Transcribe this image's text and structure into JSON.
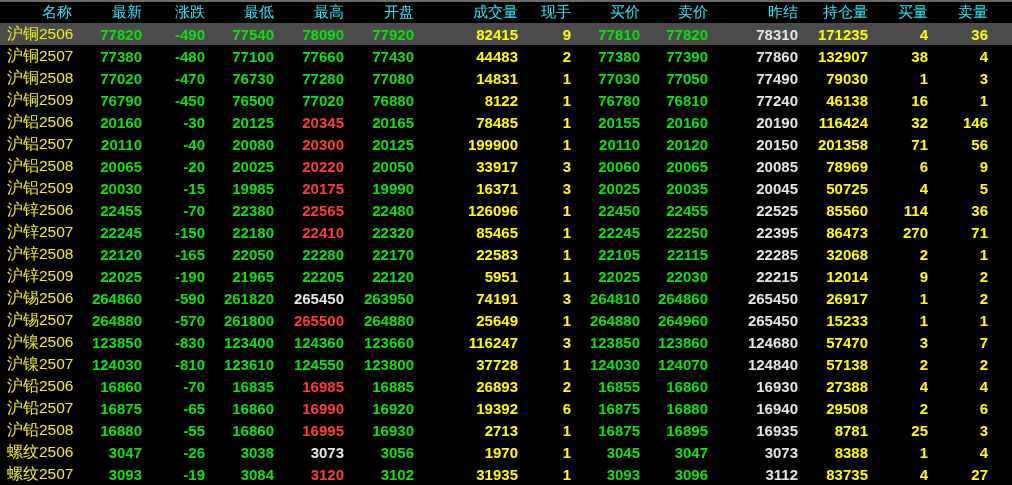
{
  "table": {
    "columns": [
      {
        "label": "名称",
        "kind": "name"
      },
      {
        "label": "最新",
        "kind": "price"
      },
      {
        "label": "涨跌",
        "kind": "price"
      },
      {
        "label": "最低",
        "kind": "price"
      },
      {
        "label": "最高",
        "kind": "price"
      },
      {
        "label": "开盘",
        "kind": "price"
      },
      {
        "label": "成交量",
        "kind": "volume"
      },
      {
        "label": "现手",
        "kind": "volume"
      },
      {
        "label": "买价",
        "kind": "price"
      },
      {
        "label": "卖价",
        "kind": "price"
      },
      {
        "label": "昨结",
        "kind": "settle"
      },
      {
        "label": "持仓量",
        "kind": "volume"
      },
      {
        "label": "买量",
        "kind": "volume"
      },
      {
        "label": "卖量",
        "kind": "volume"
      }
    ],
    "rows": [
      {
        "selected": true,
        "cells": [
          {
            "text": "沪铜2506"
          },
          {
            "text": "77820",
            "color": "#10e010"
          },
          {
            "text": "-490",
            "color": "#10e010"
          },
          {
            "text": "77540",
            "color": "#10e010"
          },
          {
            "text": "78090",
            "color": "#10e010"
          },
          {
            "text": "77920",
            "color": "#10e010"
          },
          {
            "text": "82415"
          },
          {
            "text": "9"
          },
          {
            "text": "77810",
            "color": "#10e010"
          },
          {
            "text": "77820",
            "color": "#10e010"
          },
          {
            "text": "78310"
          },
          {
            "text": "171235"
          },
          {
            "text": "4"
          },
          {
            "text": "36"
          }
        ]
      },
      {
        "selected": false,
        "cells": [
          {
            "text": "沪铜2507"
          },
          {
            "text": "77380",
            "color": "#10e010"
          },
          {
            "text": "-480",
            "color": "#10e010"
          },
          {
            "text": "77100",
            "color": "#10e010"
          },
          {
            "text": "77660",
            "color": "#10e010"
          },
          {
            "text": "77430",
            "color": "#10e010"
          },
          {
            "text": "44483"
          },
          {
            "text": "2"
          },
          {
            "text": "77380",
            "color": "#10e010"
          },
          {
            "text": "77390",
            "color": "#10e010"
          },
          {
            "text": "77860"
          },
          {
            "text": "132907"
          },
          {
            "text": "38"
          },
          {
            "text": "4"
          }
        ]
      },
      {
        "selected": false,
        "cells": [
          {
            "text": "沪铜2508"
          },
          {
            "text": "77020",
            "color": "#10e010"
          },
          {
            "text": "-470",
            "color": "#10e010"
          },
          {
            "text": "76730",
            "color": "#10e010"
          },
          {
            "text": "77280",
            "color": "#10e010"
          },
          {
            "text": "77080",
            "color": "#10e010"
          },
          {
            "text": "14831"
          },
          {
            "text": "1"
          },
          {
            "text": "77030",
            "color": "#10e010"
          },
          {
            "text": "77050",
            "color": "#10e010"
          },
          {
            "text": "77490"
          },
          {
            "text": "79030"
          },
          {
            "text": "1"
          },
          {
            "text": "3"
          }
        ]
      },
      {
        "selected": false,
        "cells": [
          {
            "text": "沪铜2509"
          },
          {
            "text": "76790",
            "color": "#10e010"
          },
          {
            "text": "-450",
            "color": "#10e010"
          },
          {
            "text": "76500",
            "color": "#10e010"
          },
          {
            "text": "77020",
            "color": "#10e010"
          },
          {
            "text": "76880",
            "color": "#10e010"
          },
          {
            "text": "8122"
          },
          {
            "text": "1"
          },
          {
            "text": "76780",
            "color": "#10e010"
          },
          {
            "text": "76810",
            "color": "#10e010"
          },
          {
            "text": "77240"
          },
          {
            "text": "46138"
          },
          {
            "text": "16"
          },
          {
            "text": "1"
          }
        ]
      },
      {
        "selected": false,
        "cells": [
          {
            "text": "沪铝2506"
          },
          {
            "text": "20160",
            "color": "#10e010"
          },
          {
            "text": "-30",
            "color": "#10e010"
          },
          {
            "text": "20125",
            "color": "#10e010"
          },
          {
            "text": "20345",
            "color": "#ff3c3c"
          },
          {
            "text": "20165",
            "color": "#10e010"
          },
          {
            "text": "78485"
          },
          {
            "text": "1"
          },
          {
            "text": "20155",
            "color": "#10e010"
          },
          {
            "text": "20160",
            "color": "#10e010"
          },
          {
            "text": "20190"
          },
          {
            "text": "116424"
          },
          {
            "text": "32"
          },
          {
            "text": "146"
          }
        ]
      },
      {
        "selected": false,
        "cells": [
          {
            "text": "沪铝2507"
          },
          {
            "text": "20110",
            "color": "#10e010"
          },
          {
            "text": "-40",
            "color": "#10e010"
          },
          {
            "text": "20080",
            "color": "#10e010"
          },
          {
            "text": "20300",
            "color": "#ff3c3c"
          },
          {
            "text": "20125",
            "color": "#10e010"
          },
          {
            "text": "199900"
          },
          {
            "text": "1"
          },
          {
            "text": "20110",
            "color": "#10e010"
          },
          {
            "text": "20120",
            "color": "#10e010"
          },
          {
            "text": "20150"
          },
          {
            "text": "201358"
          },
          {
            "text": "71"
          },
          {
            "text": "56"
          }
        ]
      },
      {
        "selected": false,
        "cells": [
          {
            "text": "沪铝2508"
          },
          {
            "text": "20065",
            "color": "#10e010"
          },
          {
            "text": "-20",
            "color": "#10e010"
          },
          {
            "text": "20025",
            "color": "#10e010"
          },
          {
            "text": "20220",
            "color": "#ff3c3c"
          },
          {
            "text": "20050",
            "color": "#10e010"
          },
          {
            "text": "33917"
          },
          {
            "text": "3"
          },
          {
            "text": "20060",
            "color": "#10e010"
          },
          {
            "text": "20065",
            "color": "#10e010"
          },
          {
            "text": "20085"
          },
          {
            "text": "78969"
          },
          {
            "text": "6"
          },
          {
            "text": "9"
          }
        ]
      },
      {
        "selected": false,
        "cells": [
          {
            "text": "沪铝2509"
          },
          {
            "text": "20030",
            "color": "#10e010"
          },
          {
            "text": "-15",
            "color": "#10e010"
          },
          {
            "text": "19985",
            "color": "#10e010"
          },
          {
            "text": "20175",
            "color": "#ff3c3c"
          },
          {
            "text": "19990",
            "color": "#10e010"
          },
          {
            "text": "16371"
          },
          {
            "text": "3"
          },
          {
            "text": "20025",
            "color": "#10e010"
          },
          {
            "text": "20035",
            "color": "#10e010"
          },
          {
            "text": "20045"
          },
          {
            "text": "50725"
          },
          {
            "text": "4"
          },
          {
            "text": "5"
          }
        ]
      },
      {
        "selected": false,
        "cells": [
          {
            "text": "沪锌2506"
          },
          {
            "text": "22455",
            "color": "#10e010"
          },
          {
            "text": "-70",
            "color": "#10e010"
          },
          {
            "text": "22380",
            "color": "#10e010"
          },
          {
            "text": "22565",
            "color": "#ff3c3c"
          },
          {
            "text": "22480",
            "color": "#10e010"
          },
          {
            "text": "126096"
          },
          {
            "text": "1"
          },
          {
            "text": "22450",
            "color": "#10e010"
          },
          {
            "text": "22455",
            "color": "#10e010"
          },
          {
            "text": "22525"
          },
          {
            "text": "85560"
          },
          {
            "text": "114"
          },
          {
            "text": "36"
          }
        ]
      },
      {
        "selected": false,
        "cells": [
          {
            "text": "沪锌2507"
          },
          {
            "text": "22245",
            "color": "#10e010"
          },
          {
            "text": "-150",
            "color": "#10e010"
          },
          {
            "text": "22180",
            "color": "#10e010"
          },
          {
            "text": "22410",
            "color": "#ff3c3c"
          },
          {
            "text": "22320",
            "color": "#10e010"
          },
          {
            "text": "85465"
          },
          {
            "text": "1"
          },
          {
            "text": "22245",
            "color": "#10e010"
          },
          {
            "text": "22250",
            "color": "#10e010"
          },
          {
            "text": "22395"
          },
          {
            "text": "86473"
          },
          {
            "text": "270"
          },
          {
            "text": "71"
          }
        ]
      },
      {
        "selected": false,
        "cells": [
          {
            "text": "沪锌2508"
          },
          {
            "text": "22120",
            "color": "#10e010"
          },
          {
            "text": "-165",
            "color": "#10e010"
          },
          {
            "text": "22050",
            "color": "#10e010"
          },
          {
            "text": "22280",
            "color": "#10e010"
          },
          {
            "text": "22170",
            "color": "#10e010"
          },
          {
            "text": "22583"
          },
          {
            "text": "1"
          },
          {
            "text": "22105",
            "color": "#10e010"
          },
          {
            "text": "22115",
            "color": "#10e010"
          },
          {
            "text": "22285"
          },
          {
            "text": "32068"
          },
          {
            "text": "2"
          },
          {
            "text": "1"
          }
        ]
      },
      {
        "selected": false,
        "cells": [
          {
            "text": "沪锌2509"
          },
          {
            "text": "22025",
            "color": "#10e010"
          },
          {
            "text": "-190",
            "color": "#10e010"
          },
          {
            "text": "21965",
            "color": "#10e010"
          },
          {
            "text": "22205",
            "color": "#10e010"
          },
          {
            "text": "22120",
            "color": "#10e010"
          },
          {
            "text": "5951"
          },
          {
            "text": "1"
          },
          {
            "text": "22025",
            "color": "#10e010"
          },
          {
            "text": "22030",
            "color": "#10e010"
          },
          {
            "text": "22215"
          },
          {
            "text": "12014"
          },
          {
            "text": "9"
          },
          {
            "text": "2"
          }
        ]
      },
      {
        "selected": false,
        "cells": [
          {
            "text": "沪锡2506"
          },
          {
            "text": "264860",
            "color": "#10e010"
          },
          {
            "text": "-590",
            "color": "#10e010"
          },
          {
            "text": "261820",
            "color": "#10e010"
          },
          {
            "text": "265450",
            "color": "#e6e6e6"
          },
          {
            "text": "263950",
            "color": "#10e010"
          },
          {
            "text": "74191"
          },
          {
            "text": "3"
          },
          {
            "text": "264810",
            "color": "#10e010"
          },
          {
            "text": "264860",
            "color": "#10e010"
          },
          {
            "text": "265450"
          },
          {
            "text": "26917"
          },
          {
            "text": "1"
          },
          {
            "text": "2"
          }
        ]
      },
      {
        "selected": false,
        "cells": [
          {
            "text": "沪锡2507"
          },
          {
            "text": "264880",
            "color": "#10e010"
          },
          {
            "text": "-570",
            "color": "#10e010"
          },
          {
            "text": "261800",
            "color": "#10e010"
          },
          {
            "text": "265500",
            "color": "#ff3c3c"
          },
          {
            "text": "264880",
            "color": "#10e010"
          },
          {
            "text": "25649"
          },
          {
            "text": "1"
          },
          {
            "text": "264880",
            "color": "#10e010"
          },
          {
            "text": "264960",
            "color": "#10e010"
          },
          {
            "text": "265450"
          },
          {
            "text": "15233"
          },
          {
            "text": "1"
          },
          {
            "text": "1"
          }
        ]
      },
      {
        "selected": false,
        "cells": [
          {
            "text": "沪镍2506"
          },
          {
            "text": "123850",
            "color": "#10e010"
          },
          {
            "text": "-830",
            "color": "#10e010"
          },
          {
            "text": "123400",
            "color": "#10e010"
          },
          {
            "text": "124360",
            "color": "#10e010"
          },
          {
            "text": "123660",
            "color": "#10e010"
          },
          {
            "text": "116247"
          },
          {
            "text": "3"
          },
          {
            "text": "123850",
            "color": "#10e010"
          },
          {
            "text": "123860",
            "color": "#10e010"
          },
          {
            "text": "124680"
          },
          {
            "text": "57470"
          },
          {
            "text": "3"
          },
          {
            "text": "7"
          }
        ]
      },
      {
        "selected": false,
        "cells": [
          {
            "text": "沪镍2507"
          },
          {
            "text": "124030",
            "color": "#10e010"
          },
          {
            "text": "-810",
            "color": "#10e010"
          },
          {
            "text": "123610",
            "color": "#10e010"
          },
          {
            "text": "124550",
            "color": "#10e010"
          },
          {
            "text": "123800",
            "color": "#10e010"
          },
          {
            "text": "37728"
          },
          {
            "text": "1"
          },
          {
            "text": "124030",
            "color": "#10e010"
          },
          {
            "text": "124070",
            "color": "#10e010"
          },
          {
            "text": "124840"
          },
          {
            "text": "57138"
          },
          {
            "text": "2"
          },
          {
            "text": "2"
          }
        ]
      },
      {
        "selected": false,
        "cells": [
          {
            "text": "沪铅2506"
          },
          {
            "text": "16860",
            "color": "#10e010"
          },
          {
            "text": "-70",
            "color": "#10e010"
          },
          {
            "text": "16835",
            "color": "#10e010"
          },
          {
            "text": "16985",
            "color": "#ff3c3c"
          },
          {
            "text": "16885",
            "color": "#10e010"
          },
          {
            "text": "26893"
          },
          {
            "text": "2"
          },
          {
            "text": "16855",
            "color": "#10e010"
          },
          {
            "text": "16860",
            "color": "#10e010"
          },
          {
            "text": "16930"
          },
          {
            "text": "27388"
          },
          {
            "text": "4"
          },
          {
            "text": "4"
          }
        ]
      },
      {
        "selected": false,
        "cells": [
          {
            "text": "沪铅2507"
          },
          {
            "text": "16875",
            "color": "#10e010"
          },
          {
            "text": "-65",
            "color": "#10e010"
          },
          {
            "text": "16860",
            "color": "#10e010"
          },
          {
            "text": "16990",
            "color": "#ff3c3c"
          },
          {
            "text": "16920",
            "color": "#10e010"
          },
          {
            "text": "19392"
          },
          {
            "text": "6"
          },
          {
            "text": "16875",
            "color": "#10e010"
          },
          {
            "text": "16880",
            "color": "#10e010"
          },
          {
            "text": "16940"
          },
          {
            "text": "29508"
          },
          {
            "text": "2"
          },
          {
            "text": "6"
          }
        ]
      },
      {
        "selected": false,
        "cells": [
          {
            "text": "沪铅2508"
          },
          {
            "text": "16880",
            "color": "#10e010"
          },
          {
            "text": "-55",
            "color": "#10e010"
          },
          {
            "text": "16860",
            "color": "#10e010"
          },
          {
            "text": "16995",
            "color": "#ff3c3c"
          },
          {
            "text": "16930",
            "color": "#10e010"
          },
          {
            "text": "2713"
          },
          {
            "text": "1"
          },
          {
            "text": "16875",
            "color": "#10e010"
          },
          {
            "text": "16895",
            "color": "#10e010"
          },
          {
            "text": "16935"
          },
          {
            "text": "8781"
          },
          {
            "text": "25"
          },
          {
            "text": "3"
          }
        ]
      },
      {
        "selected": false,
        "cells": [
          {
            "text": "螺纹2506"
          },
          {
            "text": "3047",
            "color": "#10e010"
          },
          {
            "text": "-26",
            "color": "#10e010"
          },
          {
            "text": "3038",
            "color": "#10e010"
          },
          {
            "text": "3073",
            "color": "#e6e6e6"
          },
          {
            "text": "3056",
            "color": "#10e010"
          },
          {
            "text": "1970"
          },
          {
            "text": "1"
          },
          {
            "text": "3045",
            "color": "#10e010"
          },
          {
            "text": "3047",
            "color": "#10e010"
          },
          {
            "text": "3073"
          },
          {
            "text": "8388"
          },
          {
            "text": "1"
          },
          {
            "text": "4"
          }
        ]
      },
      {
        "selected": false,
        "cells": [
          {
            "text": "螺纹2507"
          },
          {
            "text": "3093",
            "color": "#10e010"
          },
          {
            "text": "-19",
            "color": "#10e010"
          },
          {
            "text": "3084",
            "color": "#10e010"
          },
          {
            "text": "3120",
            "color": "#ff3c3c"
          },
          {
            "text": "3102",
            "color": "#10e010"
          },
          {
            "text": "31935"
          },
          {
            "text": "1"
          },
          {
            "text": "3093",
            "color": "#10e010"
          },
          {
            "text": "3096",
            "color": "#10e010"
          },
          {
            "text": "3112"
          },
          {
            "text": "83735"
          },
          {
            "text": "4"
          },
          {
            "text": "27"
          }
        ]
      }
    ]
  }
}
